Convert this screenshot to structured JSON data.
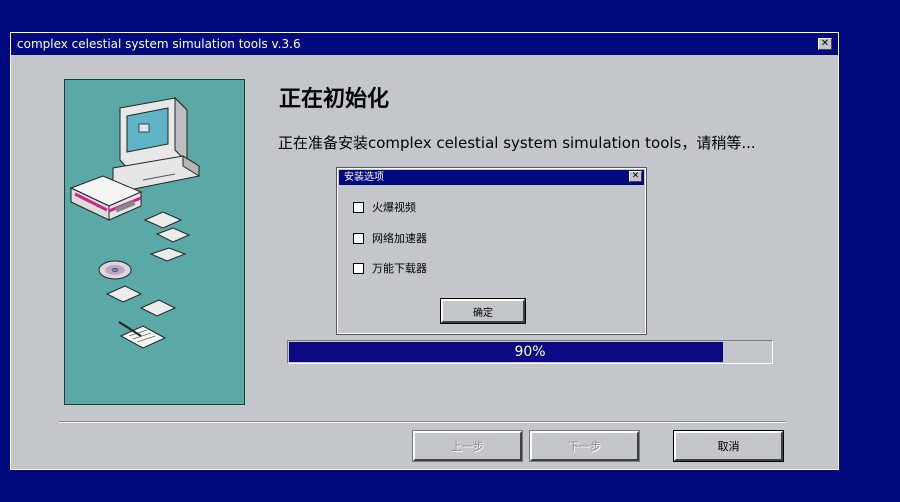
{
  "window": {
    "title": "complex celestial system simulation tools v.3.6",
    "close_glyph": "✕"
  },
  "main": {
    "heading": "正在初始化",
    "message": "正在准备安装complex celestial system simulation tools，请稍等..."
  },
  "dialog": {
    "title": "安装选项",
    "close_glyph": "✕",
    "options": [
      {
        "label": "火爆视频",
        "checked": false
      },
      {
        "label": "网络加速器",
        "checked": false
      },
      {
        "label": "万能下载器",
        "checked": false
      }
    ],
    "ok_label": "确定"
  },
  "progress": {
    "value": 90,
    "label": "90%"
  },
  "buttons": {
    "back_label": "上一步",
    "next_label": "下一步",
    "cancel_label": "取消"
  },
  "colors": {
    "desktop": "#000a7e",
    "titlebar": "#000a7e",
    "window_face": "#c3c7cb",
    "art_panel": "#5aa9a6",
    "progress_fill": "#0b0a84"
  },
  "icons": [
    "close-icon",
    "computer-icon",
    "floppy-disk-icon",
    "cd-icon",
    "document-icon"
  ]
}
